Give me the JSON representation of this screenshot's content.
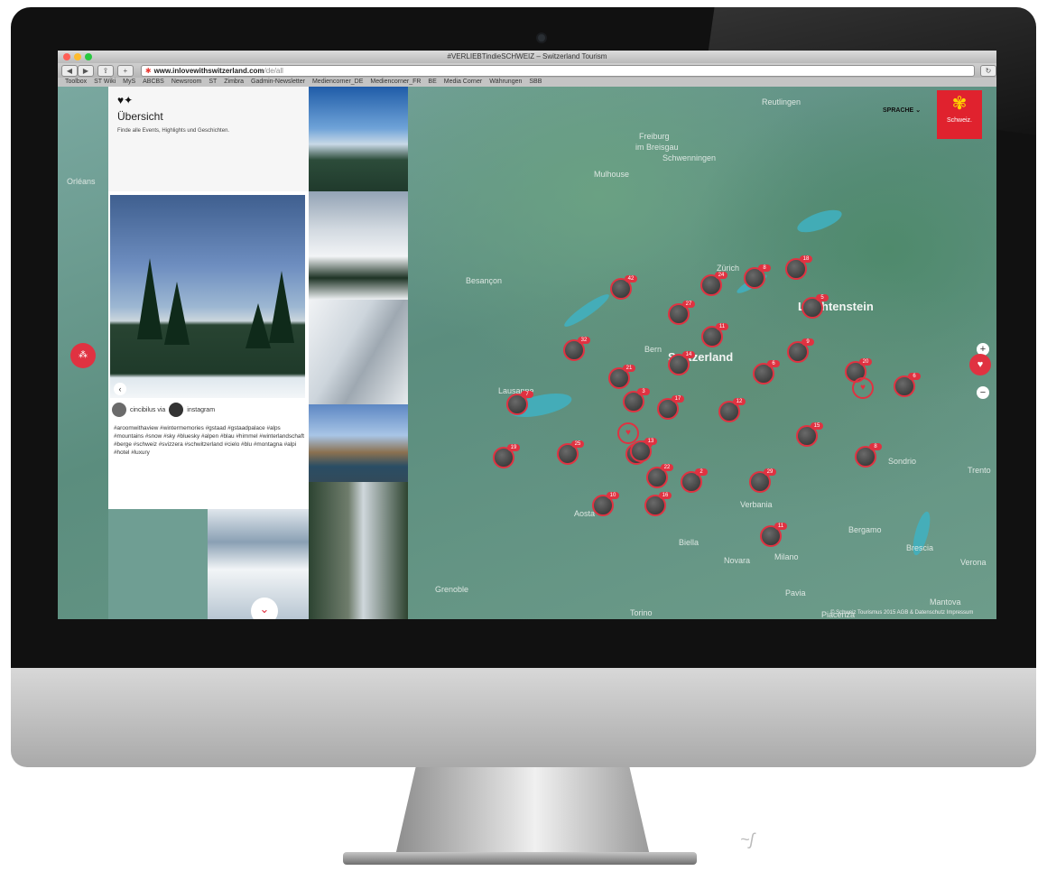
{
  "browser": {
    "window_title": "#VERLIEBTindieSCHWEIZ – Switzerland Tourism",
    "url_host": "www.inlovewithswitzerland.com",
    "url_path": "/de/all",
    "bookmarks": [
      "Toolbox",
      "ST Wiki",
      "MyS",
      "ABCBS",
      "Newsroom",
      "ST",
      "Zimbra",
      "Gadmin-Newsletter",
      "Mediencorner_DE",
      "Mediencorner_FR",
      "BE",
      "Media Corner",
      "Währungen",
      "SBB"
    ]
  },
  "sidebar": {
    "overview_title": "Übersicht",
    "overview_subtitle": "Finde alle Events, Highlights und Geschichten."
  },
  "post": {
    "author": "cincibilus via",
    "network": "instagram",
    "caption": "#aroomwithaview #wintermemories #gstaad #gstaadpalace #alps #mountains #snow #sky #bluesky #alpen #blau #himmel #winterlandschaft #berge #schweiz #svizzera #schwitzerland #cielo #blu #montagna #alpi #hotel #luxury"
  },
  "map": {
    "language_label": "SPRACHE",
    "brand_label": "Schweiz.",
    "labels": {
      "switzerland": "Switzerland",
      "liechtenstein": "Liechtenstein",
      "freiburg": "Freiburg",
      "freiburg2": "im Breisgau",
      "mulhouse": "Mulhouse",
      "besancon": "Besançon",
      "lausanne": "Lausanne",
      "bern": "Bern",
      "zurich": "Zürich",
      "aosta": "Aosta",
      "biella": "Biella",
      "novara": "Novara",
      "bergamo": "Bergamo",
      "brescia": "Brescia",
      "sondrio": "Sondrio",
      "pavia": "Pavia",
      "piacenza": "Piacenza",
      "grenoble": "Grenoble",
      "verbania": "Verbania",
      "milano": "Milano",
      "torino": "Torino",
      "trento": "Trento",
      "verona": "Verona",
      "mantova": "Mantova",
      "orleans": "Orléans",
      "reutlingen": "Reutlingen",
      "schwenningen": "Schwenningen"
    },
    "copyright": "© Schweiz Tourismus 2015 AGB & Datenschutz  Impressum",
    "zoom_in": "+",
    "zoom_out": "−",
    "markers": [
      {
        "badge": "42"
      },
      {
        "badge": "24"
      },
      {
        "badge": "8"
      },
      {
        "badge": "18"
      },
      {
        "badge": "5"
      },
      {
        "badge": "27"
      },
      {
        "badge": "11"
      },
      {
        "badge": "9"
      },
      {
        "badge": "32"
      },
      {
        "badge": "14"
      },
      {
        "badge": "6"
      },
      {
        "badge": "21"
      },
      {
        "badge": "3"
      },
      {
        "badge": "17"
      },
      {
        "badge": "12"
      },
      {
        "badge": "7"
      },
      {
        "badge": "25"
      },
      {
        "badge": "19"
      },
      {
        "badge": "4"
      },
      {
        "badge": "13"
      },
      {
        "badge": "22"
      },
      {
        "badge": "10"
      },
      {
        "badge": "16"
      },
      {
        "badge": "2"
      },
      {
        "badge": "29"
      },
      {
        "badge": "15"
      },
      {
        "badge": "8"
      },
      {
        "badge": "20"
      },
      {
        "badge": "6"
      },
      {
        "badge": "11"
      }
    ]
  }
}
